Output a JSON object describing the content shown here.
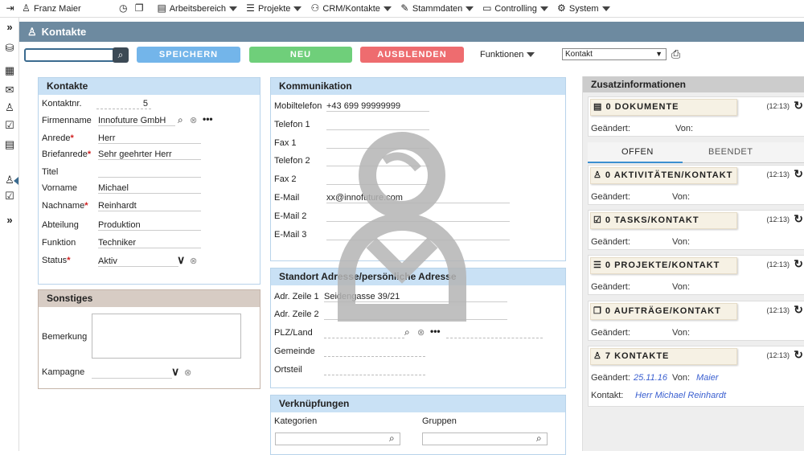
{
  "topbar": {
    "user": "Franz Maier",
    "menus": [
      {
        "label": "Arbeitsbereich",
        "icon": "clipboard-icon"
      },
      {
        "label": "Projekte",
        "icon": "gantt-icon"
      },
      {
        "label": "CRM/Kontakte",
        "icon": "people-icon"
      },
      {
        "label": "Stammdaten",
        "icon": "pencil-icon"
      },
      {
        "label": "Controlling",
        "icon": "presentation-icon"
      },
      {
        "label": "System",
        "icon": "gears-icon"
      }
    ]
  },
  "leftbar": {
    "expand_top": "»",
    "expand_bottom": "»"
  },
  "title": "Kontakte",
  "toolbar": {
    "save_label": "SPEICHERN",
    "new_label": "NEU",
    "hide_label": "AUSBLENDEN",
    "functions_label": "Funktionen",
    "view_select": "Kontakt",
    "search_value": ""
  },
  "kontakte": {
    "header": "Kontakte",
    "fields": {
      "kontaktnr_label": "Kontaktnr.",
      "kontaktnr": "5",
      "firmenname_label": "Firmenname",
      "firmenname": "Innofuture GmbH",
      "anrede_label": "Anrede",
      "anrede": "Herr",
      "briefanrede_label": "Briefanrede",
      "briefanrede": "Sehr geehrter Herr",
      "titel_label": "Titel",
      "titel": "",
      "vorname_label": "Vorname",
      "vorname": "Michael",
      "nachname_label": "Nachname",
      "nachname": "Reinhardt",
      "abteilung_label": "Abteilung",
      "abteilung": "Produktion",
      "funktion_label": "Funktion",
      "funktion": "Techniker",
      "status_label": "Status",
      "status": "Aktiv"
    }
  },
  "sonstiges": {
    "header": "Sonstiges",
    "bemerkung_label": "Bemerkung",
    "kampagne_label": "Kampagne"
  },
  "kommunikation": {
    "header": "Kommunikation",
    "mobil_label": "Mobiltelefon",
    "mobil": "+43 699 99999999",
    "tel1_label": "Telefon 1",
    "fax1_label": "Fax 1",
    "tel2_label": "Telefon 2",
    "fax2_label": "Fax 2",
    "email_label": "E-Mail",
    "email": "xx@innofuture.com",
    "email2_label": "E-Mail 2",
    "email3_label": "E-Mail 3"
  },
  "standort": {
    "header": "Standort Adresse/persönliche Adresse",
    "zeile1_label": "Adr. Zeile 1",
    "zeile1": "Seidengasse 39/21",
    "zeile2_label": "Adr. Zeile 2",
    "plz_label": "PLZ/Land",
    "gemeinde_label": "Gemeinde",
    "ortsteil_label": "Ortsteil"
  },
  "verknuepfungen": {
    "header": "Verknüpfungen",
    "kategorien_label": "Kategorien",
    "gruppen_label": "Gruppen"
  },
  "zusatz": {
    "header": "Zusatzinformationen",
    "tab_open": "OFFEN",
    "tab_done": "BEENDET",
    "cards": [
      {
        "title": "0 DOKUMENTE",
        "time": "(12:13)",
        "geaendert_label": "Geändert:",
        "von_label": "Von:",
        "icon": "documents-icon"
      },
      {
        "title": "0 AKTIVITÄTEN/KONTAKT",
        "time": "(12:13)",
        "geaendert_label": "Geändert:",
        "von_label": "Von:",
        "icon": "person-icon"
      },
      {
        "title": "0 TASKS/KONTAKT",
        "time": "(12:13)",
        "geaendert_label": "Geändert:",
        "von_label": "Von:",
        "icon": "task-icon"
      },
      {
        "title": "0 PROJEKTE/KONTAKT",
        "time": "(12:13)",
        "geaendert_label": "Geändert:",
        "von_label": "Von:",
        "icon": "gantt-icon"
      },
      {
        "title": "0 AUFTRÄGE/KONTAKT",
        "time": "(12:13)",
        "geaendert_label": "Geändert:",
        "von_label": "Von:",
        "icon": "orders-icon"
      },
      {
        "title": "7 KONTAKTE",
        "time": "(12:13)",
        "geaendert_label": "Geändert:",
        "geaendert_value": "25.11.16",
        "von_label": "Von:",
        "von_value": "Maier",
        "kontakt_label": "Kontakt:",
        "kontakt_value": "Herr Michael Reinhardt",
        "icon": "person-icon"
      }
    ]
  },
  "colors": {
    "titlebar": "#6d8aa0",
    "save": "#73b5ea",
    "new": "#6fcf7a",
    "hide": "#ee6c6f",
    "panel_head": "#c9e1f5"
  }
}
